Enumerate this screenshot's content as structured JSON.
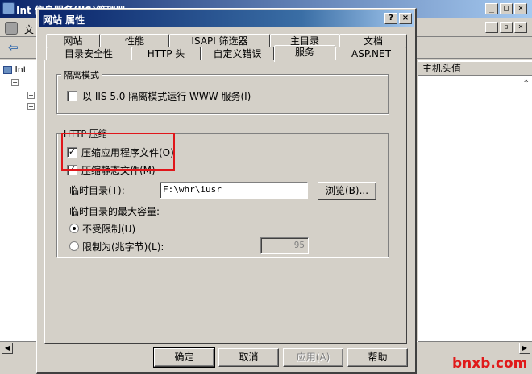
{
  "background_window": {
    "title": "Int    信息服务(IIS)管理器",
    "menu_label": "文",
    "tree_root": "Int",
    "list_column_header": "主机头值",
    "list_value": "*"
  },
  "dialog": {
    "title": "网站 属性",
    "help_glyph": "?",
    "close_glyph": "×",
    "tabs_row1": [
      "网站",
      "性能",
      "ISAPI 筛选器",
      "主目录",
      "文档"
    ],
    "tabs_row2": [
      "目录安全性",
      "HTTP 头",
      "自定义错误",
      "服务",
      "ASP.NET"
    ],
    "active_tab": "服务",
    "isolation_group": {
      "label": "隔离模式",
      "checkbox_label": "以 IIS 5.0 隔离模式运行 WWW 服务(I)",
      "checked": false
    },
    "compression_group": {
      "label": "HTTP 压缩",
      "compress_app_label": "压缩应用程序文件(O)",
      "compress_app_checked": true,
      "compress_static_label": "压缩静态文件(M)",
      "compress_static_checked": true,
      "temp_dir_label": "临时目录(T):",
      "temp_dir_value": "F:\\whr\\iusr",
      "browse_label": "浏览(B)...",
      "max_size_label": "临时目录的最大容量:",
      "unlimited_label": "不受限制(U)",
      "limited_label": "限制为(兆字节)(L):",
      "limit_value": "95",
      "selected_option": "unlimited"
    },
    "buttons": {
      "ok": "确定",
      "cancel": "取消",
      "apply": "应用(A)",
      "help": "帮助"
    }
  },
  "watermark": "bnxb.com",
  "colors": {
    "highlight_border": "#e0161a",
    "title_bar": "#0a246a",
    "face": "#d4d0c8"
  }
}
